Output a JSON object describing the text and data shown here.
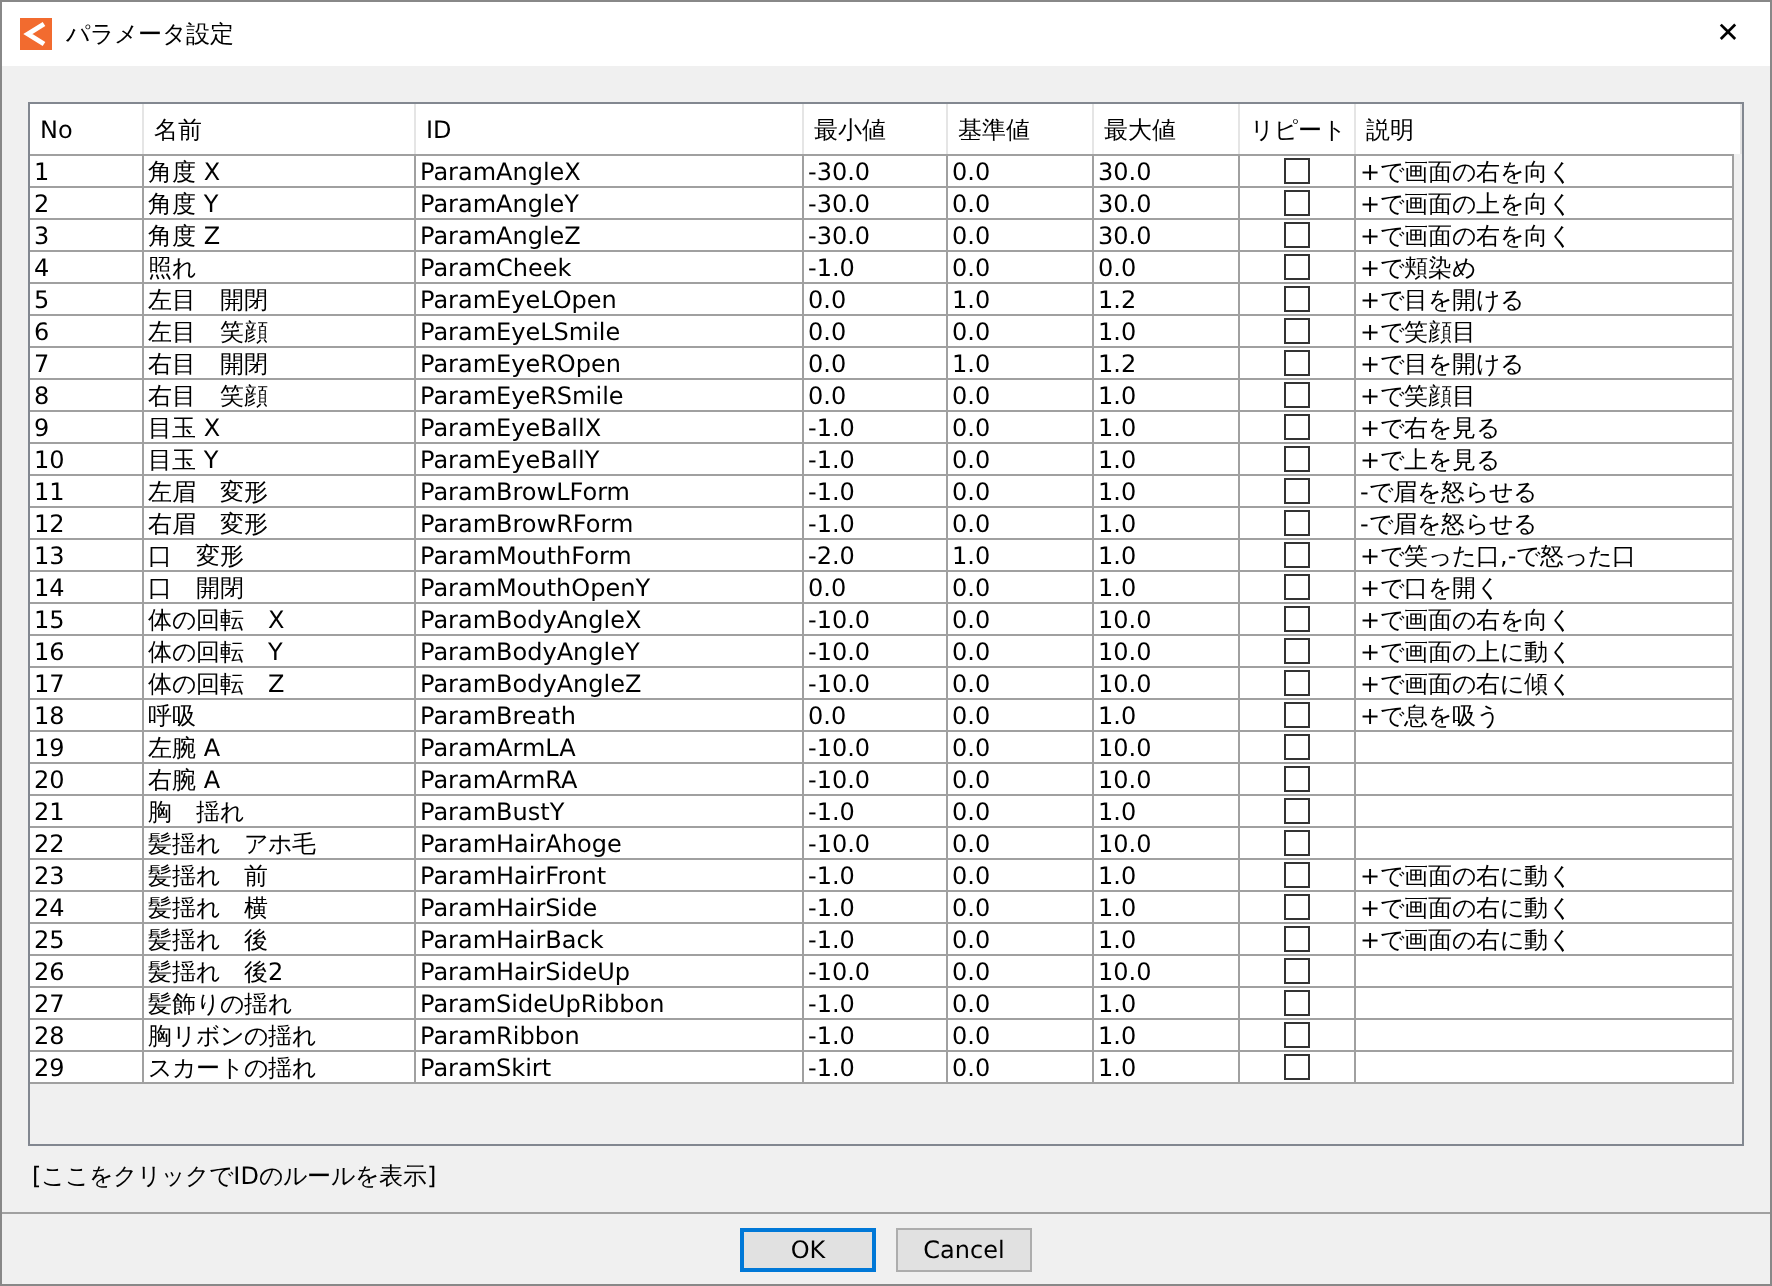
{
  "window": {
    "title": "パラメータ設定",
    "close": "✕"
  },
  "table": {
    "columns": [
      "No",
      "名前",
      "ID",
      "最小値",
      "基準値",
      "最大値",
      "リピート",
      "説明"
    ],
    "rows": [
      {
        "no": "1",
        "name": "角度 X",
        "id": "ParamAngleX",
        "min": "-30.0",
        "base": "0.0",
        "max": "30.0",
        "repeat": false,
        "desc": "+で画面の右を向く"
      },
      {
        "no": "2",
        "name": "角度 Y",
        "id": "ParamAngleY",
        "min": "-30.0",
        "base": "0.0",
        "max": "30.0",
        "repeat": false,
        "desc": "+で画面の上を向く"
      },
      {
        "no": "3",
        "name": "角度 Z",
        "id": "ParamAngleZ",
        "min": "-30.0",
        "base": "0.0",
        "max": "30.0",
        "repeat": false,
        "desc": "+で画面の右を向く"
      },
      {
        "no": "4",
        "name": "照れ",
        "id": "ParamCheek",
        "min": "-1.0",
        "base": "0.0",
        "max": "0.0",
        "repeat": false,
        "desc": "+で頬染め"
      },
      {
        "no": "5",
        "name": "左目　開閉",
        "id": "ParamEyeLOpen",
        "min": "0.0",
        "base": "1.0",
        "max": "1.2",
        "repeat": false,
        "desc": "+で目を開ける"
      },
      {
        "no": "6",
        "name": "左目　笑顔",
        "id": "ParamEyeLSmile",
        "min": "0.0",
        "base": "0.0",
        "max": "1.0",
        "repeat": false,
        "desc": "+で笑顔目"
      },
      {
        "no": "7",
        "name": "右目　開閉",
        "id": "ParamEyeROpen",
        "min": "0.0",
        "base": "1.0",
        "max": "1.2",
        "repeat": false,
        "desc": "+で目を開ける"
      },
      {
        "no": "8",
        "name": "右目　笑顔",
        "id": "ParamEyeRSmile",
        "min": "0.0",
        "base": "0.0",
        "max": "1.0",
        "repeat": false,
        "desc": "+で笑顔目"
      },
      {
        "no": "9",
        "name": "目玉 X",
        "id": "ParamEyeBallX",
        "min": "-1.0",
        "base": "0.0",
        "max": "1.0",
        "repeat": false,
        "desc": "+で右を見る"
      },
      {
        "no": "10",
        "name": "目玉 Y",
        "id": "ParamEyeBallY",
        "min": "-1.0",
        "base": "0.0",
        "max": "1.0",
        "repeat": false,
        "desc": "+で上を見る"
      },
      {
        "no": "11",
        "name": "左眉　変形",
        "id": "ParamBrowLForm",
        "min": "-1.0",
        "base": "0.0",
        "max": "1.0",
        "repeat": false,
        "desc": "-で眉を怒らせる"
      },
      {
        "no": "12",
        "name": "右眉　変形",
        "id": "ParamBrowRForm",
        "min": "-1.0",
        "base": "0.0",
        "max": "1.0",
        "repeat": false,
        "desc": "-で眉を怒らせる"
      },
      {
        "no": "13",
        "name": "口　変形",
        "id": "ParamMouthForm",
        "min": "-2.0",
        "base": "1.0",
        "max": "1.0",
        "repeat": false,
        "desc": "+で笑った口,-で怒った口"
      },
      {
        "no": "14",
        "name": "口　開閉",
        "id": "ParamMouthOpenY",
        "min": "0.0",
        "base": "0.0",
        "max": "1.0",
        "repeat": false,
        "desc": "+で口を開く"
      },
      {
        "no": "15",
        "name": "体の回転　X",
        "id": "ParamBodyAngleX",
        "min": "-10.0",
        "base": "0.0",
        "max": "10.0",
        "repeat": false,
        "desc": "+で画面の右を向く"
      },
      {
        "no": "16",
        "name": "体の回転　Y",
        "id": "ParamBodyAngleY",
        "min": "-10.0",
        "base": "0.0",
        "max": "10.0",
        "repeat": false,
        "desc": "+で画面の上に動く"
      },
      {
        "no": "17",
        "name": "体の回転　Z",
        "id": "ParamBodyAngleZ",
        "min": "-10.0",
        "base": "0.0",
        "max": "10.0",
        "repeat": false,
        "desc": "+で画面の右に傾く"
      },
      {
        "no": "18",
        "name": "呼吸",
        "id": "ParamBreath",
        "min": "0.0",
        "base": "0.0",
        "max": "1.0",
        "repeat": false,
        "desc": "+で息を吸う"
      },
      {
        "no": "19",
        "name": "左腕 A",
        "id": "ParamArmLA",
        "min": "-10.0",
        "base": "0.0",
        "max": "10.0",
        "repeat": false
      },
      {
        "no": "20",
        "name": "右腕 A",
        "id": "ParamArmRA",
        "min": "-10.0",
        "base": "0.0",
        "max": "10.0",
        "repeat": false
      },
      {
        "no": "21",
        "name": "胸　揺れ",
        "id": "ParamBustY",
        "min": "-1.0",
        "base": "0.0",
        "max": "1.0",
        "repeat": false
      },
      {
        "no": "22",
        "name": "髪揺れ　アホ毛",
        "id": "ParamHairAhoge",
        "min": "-10.0",
        "base": "0.0",
        "max": "10.0",
        "repeat": false
      },
      {
        "no": "23",
        "name": "髪揺れ　前",
        "id": "ParamHairFront",
        "min": "-1.0",
        "base": "0.0",
        "max": "1.0",
        "repeat": false,
        "desc": "+で画面の右に動く"
      },
      {
        "no": "24",
        "name": "髪揺れ　横",
        "id": "ParamHairSide",
        "min": "-1.0",
        "base": "0.0",
        "max": "1.0",
        "repeat": false,
        "desc": "+で画面の右に動く"
      },
      {
        "no": "25",
        "name": "髪揺れ　後",
        "id": "ParamHairBack",
        "min": "-1.0",
        "base": "0.0",
        "max": "1.0",
        "repeat": false,
        "desc": "+で画面の右に動く"
      },
      {
        "no": "26",
        "name": "髪揺れ　後2",
        "id": "ParamHairSideUp",
        "min": "-10.0",
        "base": "0.0",
        "max": "10.0",
        "repeat": false
      },
      {
        "no": "27",
        "name": "髪飾りの揺れ",
        "id": "ParamSideUpRibbon",
        "min": "-1.0",
        "base": "0.0",
        "max": "1.0",
        "repeat": false
      },
      {
        "no": "28",
        "name": "胸リボンの揺れ",
        "id": "ParamRibbon",
        "min": "-1.0",
        "base": "0.0",
        "max": "1.0",
        "repeat": false
      },
      {
        "no": "29",
        "name": "スカートの揺れ",
        "id": "ParamSkirt",
        "min": "-1.0",
        "base": "0.0",
        "max": "1.0",
        "repeat": false
      }
    ]
  },
  "rule_link": "[ここをクリックでIDのルールを表示]",
  "buttons": [
    {
      "label": "OK",
      "default": true
    },
    {
      "label": "Cancel",
      "default": false
    }
  ]
}
